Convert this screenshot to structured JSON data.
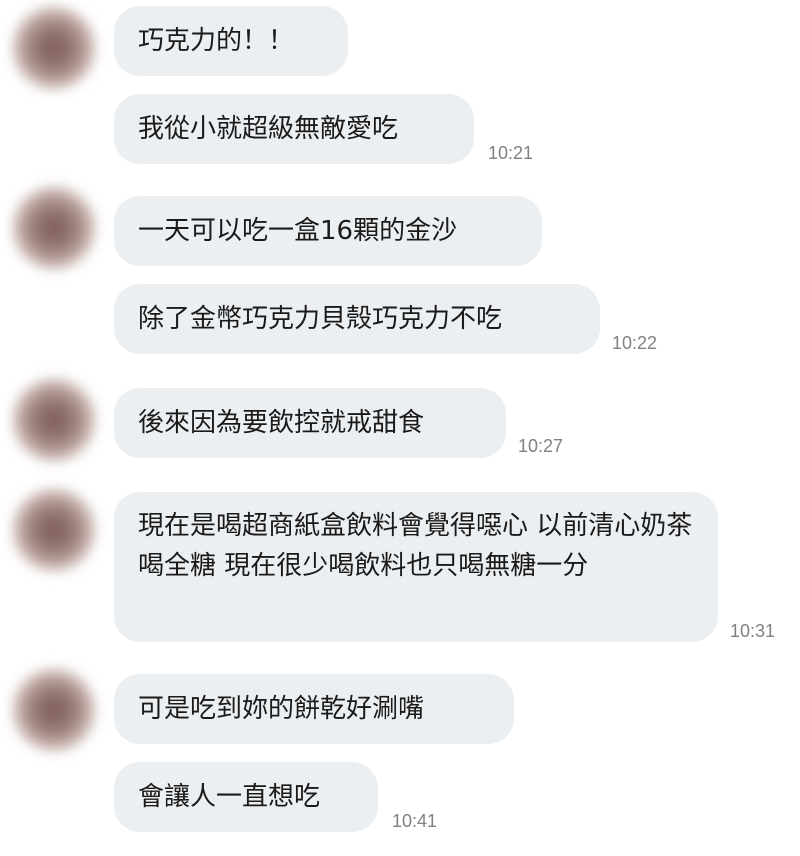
{
  "chat": {
    "messages": [
      {
        "text": "巧克力的！！",
        "time": ""
      },
      {
        "text": "我從小就超級無敵愛吃",
        "time": "10:21"
      },
      {
        "text": "一天可以吃一盒16顆的金沙",
        "time": ""
      },
      {
        "text": "除了金幣巧克力貝殼巧克力不吃",
        "time": "10:22"
      },
      {
        "text": "後來因為要飲控就戒甜食",
        "time": "10:27"
      },
      {
        "text": "現在是喝超商紙盒飲料會覺得噁心 以前清心奶茶喝全糖 現在很少喝飲料也只喝無糖一分",
        "time": "10:31"
      },
      {
        "text": "可是吃到妳的餅乾好涮嘴",
        "time": ""
      },
      {
        "text": "會讓人一直想吃",
        "time": "10:41"
      }
    ]
  }
}
